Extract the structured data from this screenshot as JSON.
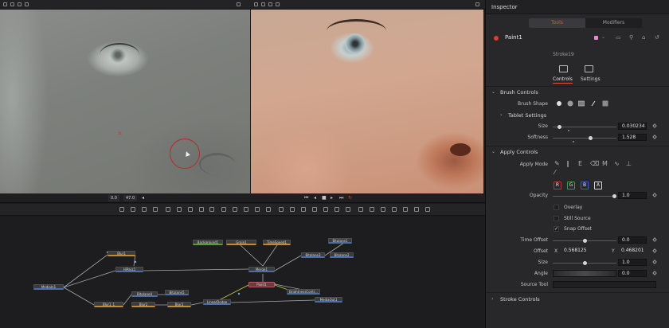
{
  "transport": {
    "start_frame": "0.0",
    "end_frame": "47.0"
  },
  "nodes": [
    {
      "id": "background",
      "label": "Background1",
      "color": "green"
    },
    {
      "id": "grain",
      "label": "Grain1",
      "color": "orange"
    },
    {
      "id": "timespeed",
      "label": "TimeSpeed1",
      "color": "orange"
    },
    {
      "id": "blur1",
      "label": "Blur1",
      "color": "orange"
    },
    {
      "id": "hipass",
      "label": "HiPass1",
      "color": "blue"
    },
    {
      "id": "merge",
      "label": "Merge1",
      "color": "blue"
    },
    {
      "id": "bitplane3",
      "label": "Bitplane3",
      "color": "blue"
    },
    {
      "id": "bitplane1",
      "label": "Bitplane1",
      "color": "blue"
    },
    {
      "id": "bitplane2",
      "label": "Bitplane2",
      "color": "blue"
    },
    {
      "id": "mediain",
      "label": "MediaIn1",
      "color": "blue"
    },
    {
      "id": "paint",
      "label": "Paint1",
      "color": "active"
    },
    {
      "id": "bitplane4",
      "label": "Bitplane4",
      "color": "blue"
    },
    {
      "id": "bitplane5",
      "label": "Bitplane5",
      "color": "blue"
    },
    {
      "id": "brightness",
      "label": "BrightnessContr...",
      "color": "blue"
    },
    {
      "id": "blur1_1",
      "label": "Blur1_1",
      "color": "orange"
    },
    {
      "id": "blur2",
      "label": "Blur2",
      "color": "orange"
    },
    {
      "id": "blur3",
      "label": "Blur3",
      "color": "orange"
    },
    {
      "id": "lineardodge",
      "label": "LinearDodge",
      "color": "blue"
    },
    {
      "id": "mediaout",
      "label": "MediaOut1",
      "color": "blue"
    }
  ],
  "inspector": {
    "title": "Inspector",
    "tabs": {
      "tools": "Tools",
      "modifiers": "Modifiers"
    },
    "tool_name": "Paint1",
    "stroke_name": "Stroke19",
    "subtabs": {
      "controls": "Controls",
      "settings": "Settings"
    },
    "brush_controls": {
      "title": "Brush Controls",
      "brush_shape_label": "Brush Shape",
      "tablet_settings": "Tablet Settings",
      "size_label": "Size",
      "size_value": "0.030234",
      "size_level": 0.08,
      "softness_label": "Softness",
      "softness_value": "1.528",
      "softness_level": 0.6
    },
    "apply_controls": {
      "title": "Apply Controls",
      "apply_mode_label": "Apply Mode",
      "channels": [
        {
          "label": "R",
          "color": "#b53a36"
        },
        {
          "label": "G",
          "color": "#3f9a45"
        },
        {
          "label": "B",
          "color": "#3b5fb5"
        },
        {
          "label": "A",
          "color": "#d8d8d8"
        }
      ],
      "opacity_label": "Opacity",
      "opacity_value": "1.0",
      "opacity_level": 1.0,
      "overlay_label": "Overlay",
      "overlay_checked": false,
      "still_source_label": "Still Source",
      "still_source_checked": false,
      "snap_offset_label": "Snap Offset",
      "snap_offset_checked": true,
      "time_offset_label": "Time Offset",
      "time_offset_value": "0.0",
      "time_offset_level": 0.5,
      "offset_label": "Offset",
      "offset_x_label": "X",
      "offset_x_value": "0.568125",
      "offset_y_label": "Y",
      "offset_y_value": "0.468201",
      "size_label": "Size",
      "size_value": "1.0",
      "size_level": 0.5,
      "angle_label": "Angle",
      "angle_value": "0.0",
      "source_tool_label": "Source Tool"
    },
    "stroke_controls": {
      "title": "Stroke Controls"
    }
  }
}
